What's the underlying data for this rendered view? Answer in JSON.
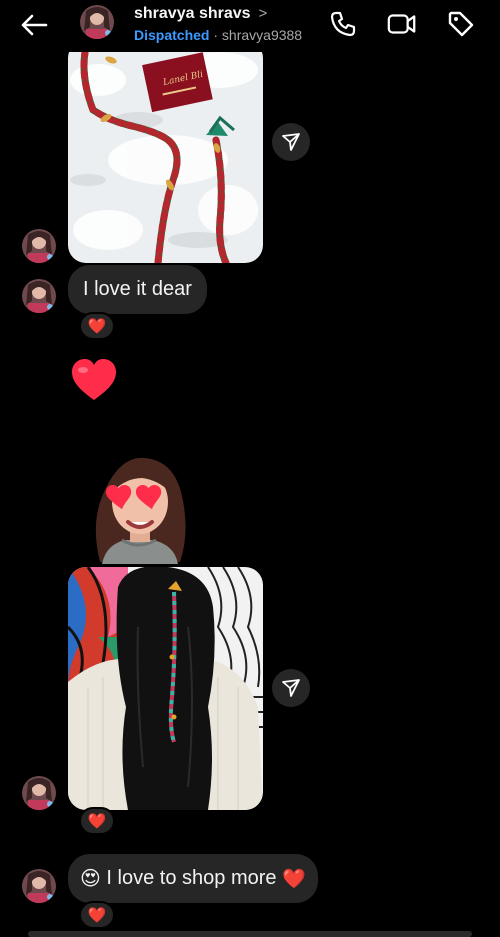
{
  "header": {
    "contact_name": "shravya shravs",
    "chevron": ">",
    "status": "Dispatched",
    "separator": " · ",
    "username": "shravya9388",
    "icons": [
      "back-arrow-icon",
      "phone-icon",
      "video-icon",
      "tag-icon"
    ]
  },
  "messages": {
    "photo1": {
      "type": "image",
      "description_icon": "share-icon"
    },
    "text1": {
      "text": "I love it dear",
      "reaction": "❤️"
    },
    "big_heart": {
      "emoji": "❤️"
    },
    "sticker": {
      "type": "avatar-sticker"
    },
    "photo2": {
      "type": "image",
      "reaction": "❤️"
    },
    "text2": {
      "emoji": "😍",
      "text": " I love to shop more ",
      "emoji_end": "❤️",
      "reaction": "❤️"
    }
  },
  "colors": {
    "background": "#000000",
    "bubble": "#262626",
    "status": "#3d9bff",
    "heart": "#ff2d4a"
  }
}
